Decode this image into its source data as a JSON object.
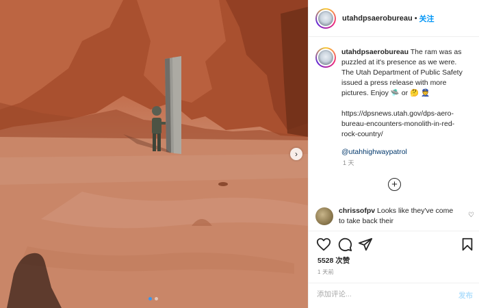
{
  "media": {
    "next_icon": "chevron-right-icon",
    "carousel": {
      "count": 2,
      "active": 1
    }
  },
  "header": {
    "username": "utahdpsaerobureau",
    "separator": "•",
    "follow_label": "关注"
  },
  "caption": {
    "username": "utahdpsaerobureau",
    "text": " The ram was as puzzled at it's presence as we were. The Utah Department of Public Safety issued a press release with more pictures. Enjoy 🛸 or 🤔 👮",
    "url": "https://dpsnews.utah.gov/dps-aero-bureau-encounters-monolith-in-red-rock-country/",
    "mention": "@utahhighwaypatrol",
    "time": "1 天"
  },
  "load_more_icon": "plus-circle-icon",
  "comments": [
    {
      "username": "chrissofpv",
      "text": " Looks like they've come to take back their"
    }
  ],
  "actions": {
    "like_icon": "heart-icon",
    "comment_icon": "comment-icon",
    "share_icon": "paper-plane-icon",
    "save_icon": "bookmark-icon"
  },
  "likes_label": "5528 次赞",
  "posted_time": "1 天前",
  "comment_bar": {
    "placeholder": "添加评论...",
    "post_label": "发布"
  },
  "colors": {
    "link": "#0095f6",
    "mention": "#00376b",
    "muted": "#8e8e8e",
    "post_disabled": "#b2dffc"
  }
}
